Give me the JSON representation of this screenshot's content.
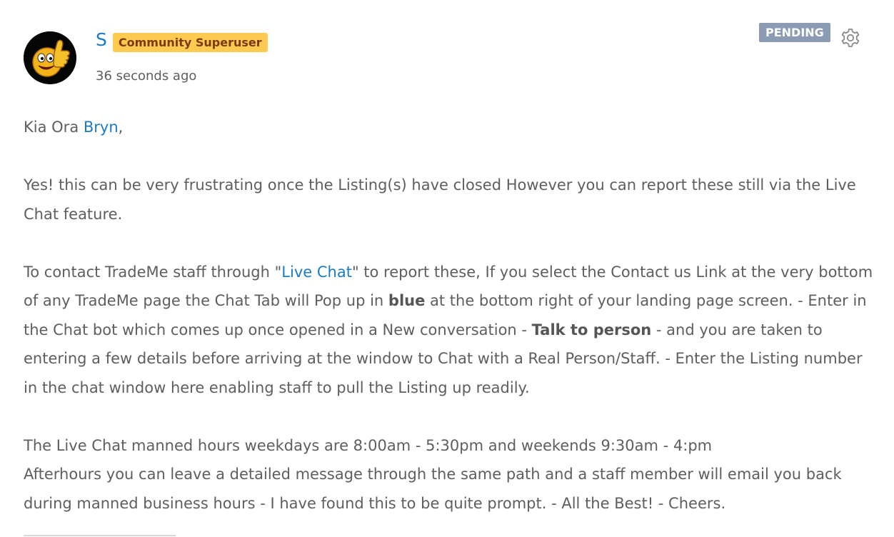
{
  "post": {
    "author": {
      "name": "S",
      "rank": "Community Superuser",
      "avatar_icon": "thumbs-up-smiley-icon"
    },
    "timestamp": "36 seconds ago",
    "status": "PENDING",
    "options_icon": "gear-icon",
    "colors": {
      "link": "#1b7bc4",
      "rank_badge_bg": "#fdcb4f",
      "rank_badge_text": "#7a3a14",
      "pending_bg": "#8c9bb4",
      "body_text": "#5e5e5e"
    },
    "body": {
      "p1": {
        "before": "Kia Ora ",
        "mention": "Bryn",
        "after": ","
      },
      "p2": "Yes! this can be very frustrating once the Listing(s) have closed However you can report these still via the Live Chat feature.",
      "p3": {
        "t1": "To contact TradeMe staff through \"",
        "link": "Live Chat",
        "t2": "\" to report these, If you select the Contact us Link at the very bottom of any TradeMe page the Chat Tab will Pop up in ",
        "bold1": "blue",
        "t3": " at the bottom right of your landing page screen. - Enter in the Chat bot which comes up once opened in a New conversation - ",
        "bold2": "Talk to person",
        "t4": " - and you are taken to entering a few details before arriving at the window to Chat with a Real Person/Staff. - Enter the Listing number in the chat window here enabling staff to pull the Listing up readily."
      },
      "p4": {
        "line1": "The Live Chat manned hours weekdays are 8:00am - 5:30pm and weekends 9:30am - 4:pm",
        "line2": "Afterhours you can leave a detailed message through the same path and a staff member will email you back during manned business hours - I have found this to be quite prompt. - All the Best! - Cheers."
      }
    }
  }
}
